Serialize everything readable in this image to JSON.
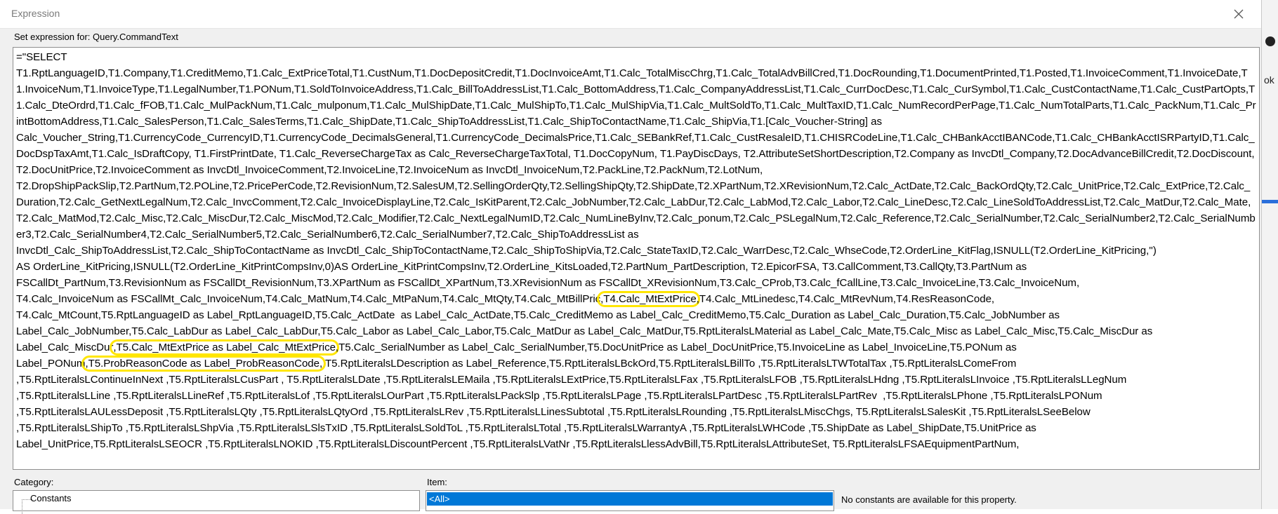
{
  "window": {
    "title": "Expression"
  },
  "header": {
    "set_expression_label": "Set expression for: Query.CommandText"
  },
  "expression": {
    "segments": [
      {
        "text": "=\"SELECT\nT1.RptLanguageID,T1.Company,T1.CreditMemo,T1.Calc_ExtPriceTotal,T1.CustNum,T1.DocDepositCredit,T1.DocInvoiceAmt,T1.Calc_TotalMiscChrg,T1.Calc_TotalAdvBillCred,T1.DocRounding,T1.DocumentPrinted,T1.Posted,T1.InvoiceComment,T1.InvoiceDate,T1.InvoiceNum,T1.InvoiceType,T1.LegalNumber,T1.PONum,T1.SoldToInvoiceAddress,T1.Calc_BillToAddressList,T1.Calc_BottomAddress,T1.Calc_CompanyAddressList,T1.Calc_CurrDocDesc,T1.Calc_CurSymbol,T1.Calc_CustContactName,T1.Calc_CustPartOpts,T1.Calc_DteOrdrd,T1.Calc_fFOB,T1.Calc_MulPackNum,T1.Calc_mulponum,T1.Calc_MulShipDate,T1.Calc_MulShipTo,T1.Calc_MulShipVia,T1.Calc_MultSoldTo,T1.Calc_MultTaxID,T1.Calc_NumRecordPerPage,T1.Calc_NumTotalParts,T1.Calc_PackNum,T1.Calc_PrintBottomAddress,T1.Calc_SalesPerson,T1.Calc_SalesTerms,T1.Calc_ShipDate,T1.Calc_ShipToAddressList,T1.Calc_ShipToContactName,T1.Calc_ShipVia,T1.[Calc_Voucher-String] as\nCalc_Voucher_String,T1.CurrencyCode_CurrencyID,T1.CurrencyCode_DecimalsGeneral,T1.CurrencyCode_DecimalsPrice,T1.Calc_SEBankRef,T1.Calc_CustResaleID,T1.CHISRCodeLine,T1.Calc_CHBankAcctIBANCode,T1.Calc_CHBankAcctISRPartyID,T1.Calc_DocDspTaxAmt,T1.Calc_IsDraftCopy, T1.FirstPrintDate, T1.Calc_ReverseChargeTax as Calc_ReverseChargeTaxTotal, T1.DocCopyNum, T1.PayDiscDays, T2.AttributeSetShortDescription,T2.Company as InvcDtl_Company,T2.DocAdvanceBillCredit,T2.DocDiscount,T2.DocUnitPrice,T2.InvoiceComment as InvcDtl_InvoiceComment,T2.InvoiceLine,T2.InvoiceNum as InvcDtl_InvoiceNum,T2.PackLine,T2.PackNum,T2.LotNum,\nT2.DropShipPackSlip,T2.PartNum,T2.POLine,T2.PricePerCode,T2.RevisionNum,T2.SalesUM,T2.SellingOrderQty,T2.SellingShipQty,T2.ShipDate,T2.XPartNum,T2.XRevisionNum,T2.Calc_ActDate,T2.Calc_BackOrdQty,T2.Calc_UnitPrice,T2.Calc_ExtPrice,T2.Calc_Duration,T2.Calc_GetNextLegalNum,T2.Calc_InvcComment,T2.Calc_InvoiceDisplayLine,T2.Calc_IsKitParent,T2.Calc_JobNumber,T2.Calc_LabDur,T2.Calc_LabMod,T2.Calc_Labor,T2.Calc_LineDesc,T2.Calc_LineSoldToAddressList,T2.Calc_MatDur,T2.Calc_Mate,T2.Calc_MatMod,T2.Calc_Misc,T2.Calc_MiscDur,T2.Calc_MiscMod,T2.Calc_Modifier,T2.Calc_NextLegalNumID,T2.Calc_NumLineByInv,T2.Calc_ponum,T2.Calc_PSLegalNum,T2.Calc_Reference,T2.Calc_SerialNumber,T2.Calc_SerialNumber2,T2.Calc_SerialNumber3,T2.Calc_SerialNumber4,T2.Calc_SerialNumber5,T2.Calc_SerialNumber6,T2.Calc_SerialNumber7,T2.Calc_ShipToAddressList as\nInvcDtl_Calc_ShipToAddressList,T2.Calc_ShipToContactName as InvcDtl_Calc_ShipToContactName,T2.Calc_ShipToShipVia,T2.Calc_StateTaxID,T2.Calc_WarrDesc,T2.Calc_WhseCode,T2.OrderLine_KitFlag,ISNULL(T2.OrderLine_KitPricing,'')\nAS OrderLine_KitPricing,ISNULL(T2.OrderLine_KitPrintCompsInv,0)AS OrderLine_KitPrintCompsInv,T2.OrderLine_KitsLoaded,T2.PartNum_PartDescription, T2.EpicorFSA, T3.CallComment,T3.CallQty,T3.PartNum as\nFSCallDt_PartNum,T3.RevisionNum as FSCallDt_RevisionNum,T3.XPartNum as FSCallDt_XPartNum,T3.XRevisionNum as FSCallDt_XRevisionNum,T3.Calc_CProb,T3.Calc_fCallLine,T3.Calc_InvoiceLine,T3.Calc_InvoiceNum,\nT4.Calc_InvoiceNum as FSCallMt_Calc_InvoiceNum,T4.Calc_MatNum,T4.Calc_MtPaNum,T4.Calc_MtQty,T4.Calc_MtBillPric",
        "hl": false
      },
      {
        "text": ",T4.Calc_MtExtPrice",
        "hl": true
      },
      {
        "text": ",T4.Calc_MtLinedesc,T4.Calc_MtRevNum,T4.ResReasonCode,\nT4.Calc_MtCount,T5.RptLanguageID as Label_RptLanguageID,T5.Calc_ActDate  as Label_Calc_ActDate,T5.Calc_CreditMemo as Label_Calc_CreditMemo,T5.Calc_Duration as Label_Calc_Duration,T5.Calc_JobNumber as\nLabel_Calc_JobNumber,T5.Calc_LabDur as Label_Calc_LabDur,T5.Calc_Labor as Label_Calc_Labor,T5.Calc_MatDur as Label_Calc_MatDur,T5.RptLiteralsLMaterial as Label_Calc_Mate,T5.Calc_Misc as Label_Calc_Misc,T5.Calc_MiscDur as\nLabel_Calc_MiscDur",
        "hl": false
      },
      {
        "text": ",T5.Calc_MtExtPrice as Label_Calc_MtExtPrice",
        "hl": true
      },
      {
        "text": ",T5.Calc_SerialNumber as Label_Calc_SerialNumber,T5.DocUnitPrice as Label_DocUnitPrice,T5.InvoiceLine as Label_InvoiceLine,T5.PONum as\nLabel_PONum",
        "hl": false
      },
      {
        "text": ",T5.ProbReasonCode as Label_ProbReasonCode,",
        "hl": true
      },
      {
        "text": " T5.RptLiteralsLDescription as Label_Reference,T5.RptLiteralsLBckOrd,T5.RptLiteralsLBillTo ,T5.RptLiteralsLTWTotalTax ,T5.RptLiteralsLComeFrom\n,T5.RptLiteralsLContinueInNext ,T5.RptLiteralsLCusPart , T5.RptLiteralsLDate ,T5.RptLiteralsLEMaila ,T5.RptLiteralsLExtPrice,T5.RptLiteralsLFax ,T5.RptLiteralsLFOB ,T5.RptLiteralsLHdng ,T5.RptLiteralsLInvoice ,T5.RptLiteralsLLegNum\n,T5.RptLiteralsLLine ,T5.RptLiteralsLLineRef ,T5.RptLiteralsLof ,T5.RptLiteralsLOurPart ,T5.RptLiteralsLPackSlp ,T5.RptLiteralsLPage ,T5.RptLiteralsLPartDesc ,T5.RptLiteralsLPartRev  ,T5.RptLiteralsLPhone ,T5.RptLiteralsLPONum\n,T5.RptLiteralsLAULessDeposit ,T5.RptLiteralsLQty ,T5.RptLiteralsLQtyOrd ,T5.RptLiteralsLRev ,T5.RptLiteralsLLinesSubtotal ,T5.RptLiteralsLRounding ,T5.RptLiteralsLMiscChgs, T5.RptLiteralsLSalesKit ,T5.RptLiteralsLSeeBelow\n,T5.RptLiteralsLShipTo ,T5.RptLiteralsLShpVia ,T5.RptLiteralsLSlsTxID ,T5.RptLiteralsLSoldToL ,T5.RptLiteralsLTotal ,T5.RptLiteralsLWarrantyA ,T5.RptLiteralsLWHCode ,T5.ShipDate as Label_ShipDate,T5.UnitPrice as\nLabel_UnitPrice,T5.RptLiteralsLSEOCR ,T5.RptLiteralsLNOKID ,T5.RptLiteralsLDiscountPercent ,T5.RptLiteralsLVatNr ,T5.RptLiteralsLlessAdvBill,T5.RptLiteralsLAttributeSet, T5.RptLiteralsLFSAEquipmentPartNum,",
        "hl": false
      }
    ]
  },
  "category": {
    "label": "Category:",
    "items": [
      "Constants"
    ]
  },
  "item": {
    "label": "Item:",
    "selected": "<All>"
  },
  "description": {
    "text": "No constants are available for this property."
  },
  "background_app": {
    "text": "ok"
  },
  "colors": {
    "highlight": "#ffe600",
    "selection": "#0078d7"
  }
}
